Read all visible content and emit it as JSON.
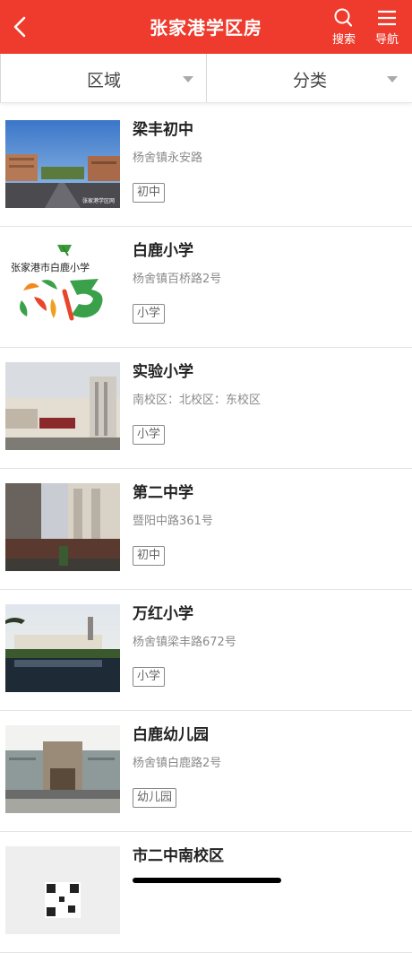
{
  "header": {
    "title": "张家港学区房",
    "search_label": "搜索",
    "nav_label": "导航",
    "bg_color": "#ef3b2d"
  },
  "filters": {
    "region": "区域",
    "category": "分类"
  },
  "schools": [
    {
      "name": "梁丰初中",
      "address": "杨舍镇永安路",
      "tag": "初中"
    },
    {
      "name": "白鹿小学",
      "address": "杨舍镇百桥路2号",
      "tag": "小学"
    },
    {
      "name": "实验小学",
      "address": "南校区：北校区：东校区",
      "tag": "小学"
    },
    {
      "name": "第二中学",
      "address": "暨阳中路361号",
      "tag": "初中"
    },
    {
      "name": "万红小学",
      "address": "杨舍镇梁丰路672号",
      "tag": "小学"
    },
    {
      "name": "白鹿幼儿园",
      "address": "杨舍镇白鹿路2号",
      "tag": "幼儿园"
    },
    {
      "name": "市二中南校区",
      "address": "",
      "tag": ""
    }
  ],
  "logo_text": "张家港市白鹿小学",
  "watermark": "张家港学区网"
}
